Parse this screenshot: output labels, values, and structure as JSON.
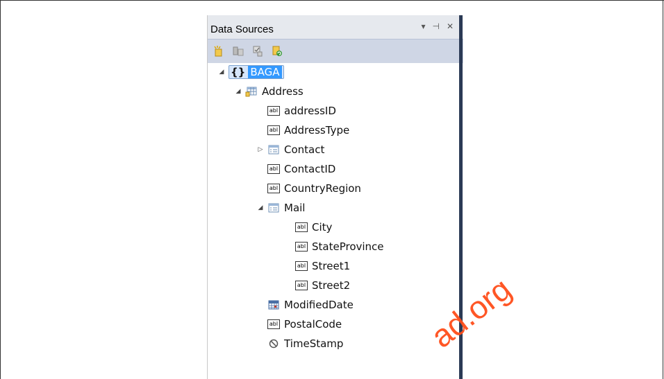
{
  "panel": {
    "title": "Data Sources",
    "controls": {
      "dropdown": "▾",
      "pin": "⊣",
      "close": "✕"
    },
    "toolbar": [
      {
        "name": "add-data-source-icon"
      },
      {
        "name": "edit-dataset-designer-icon"
      },
      {
        "name": "configure-dataset-icon"
      },
      {
        "name": "refresh-icon"
      }
    ]
  },
  "tree": {
    "root": "BAGA",
    "entity": "Address",
    "items": {
      "addressID": "addressID",
      "AddressType": "AddressType",
      "Contact": "Contact",
      "ContactID": "ContactID",
      "CountryRegion": "CountryRegion",
      "Mail": "Mail",
      "City": "City",
      "StateProvince": "StateProvince",
      "Street1": "Street1",
      "Street2": "Street2",
      "ModifiedDate": "ModifiedDate",
      "PostalCode": "PostalCode",
      "TimeStamp": "TimeStamp"
    }
  },
  "watermark": "ad.org"
}
